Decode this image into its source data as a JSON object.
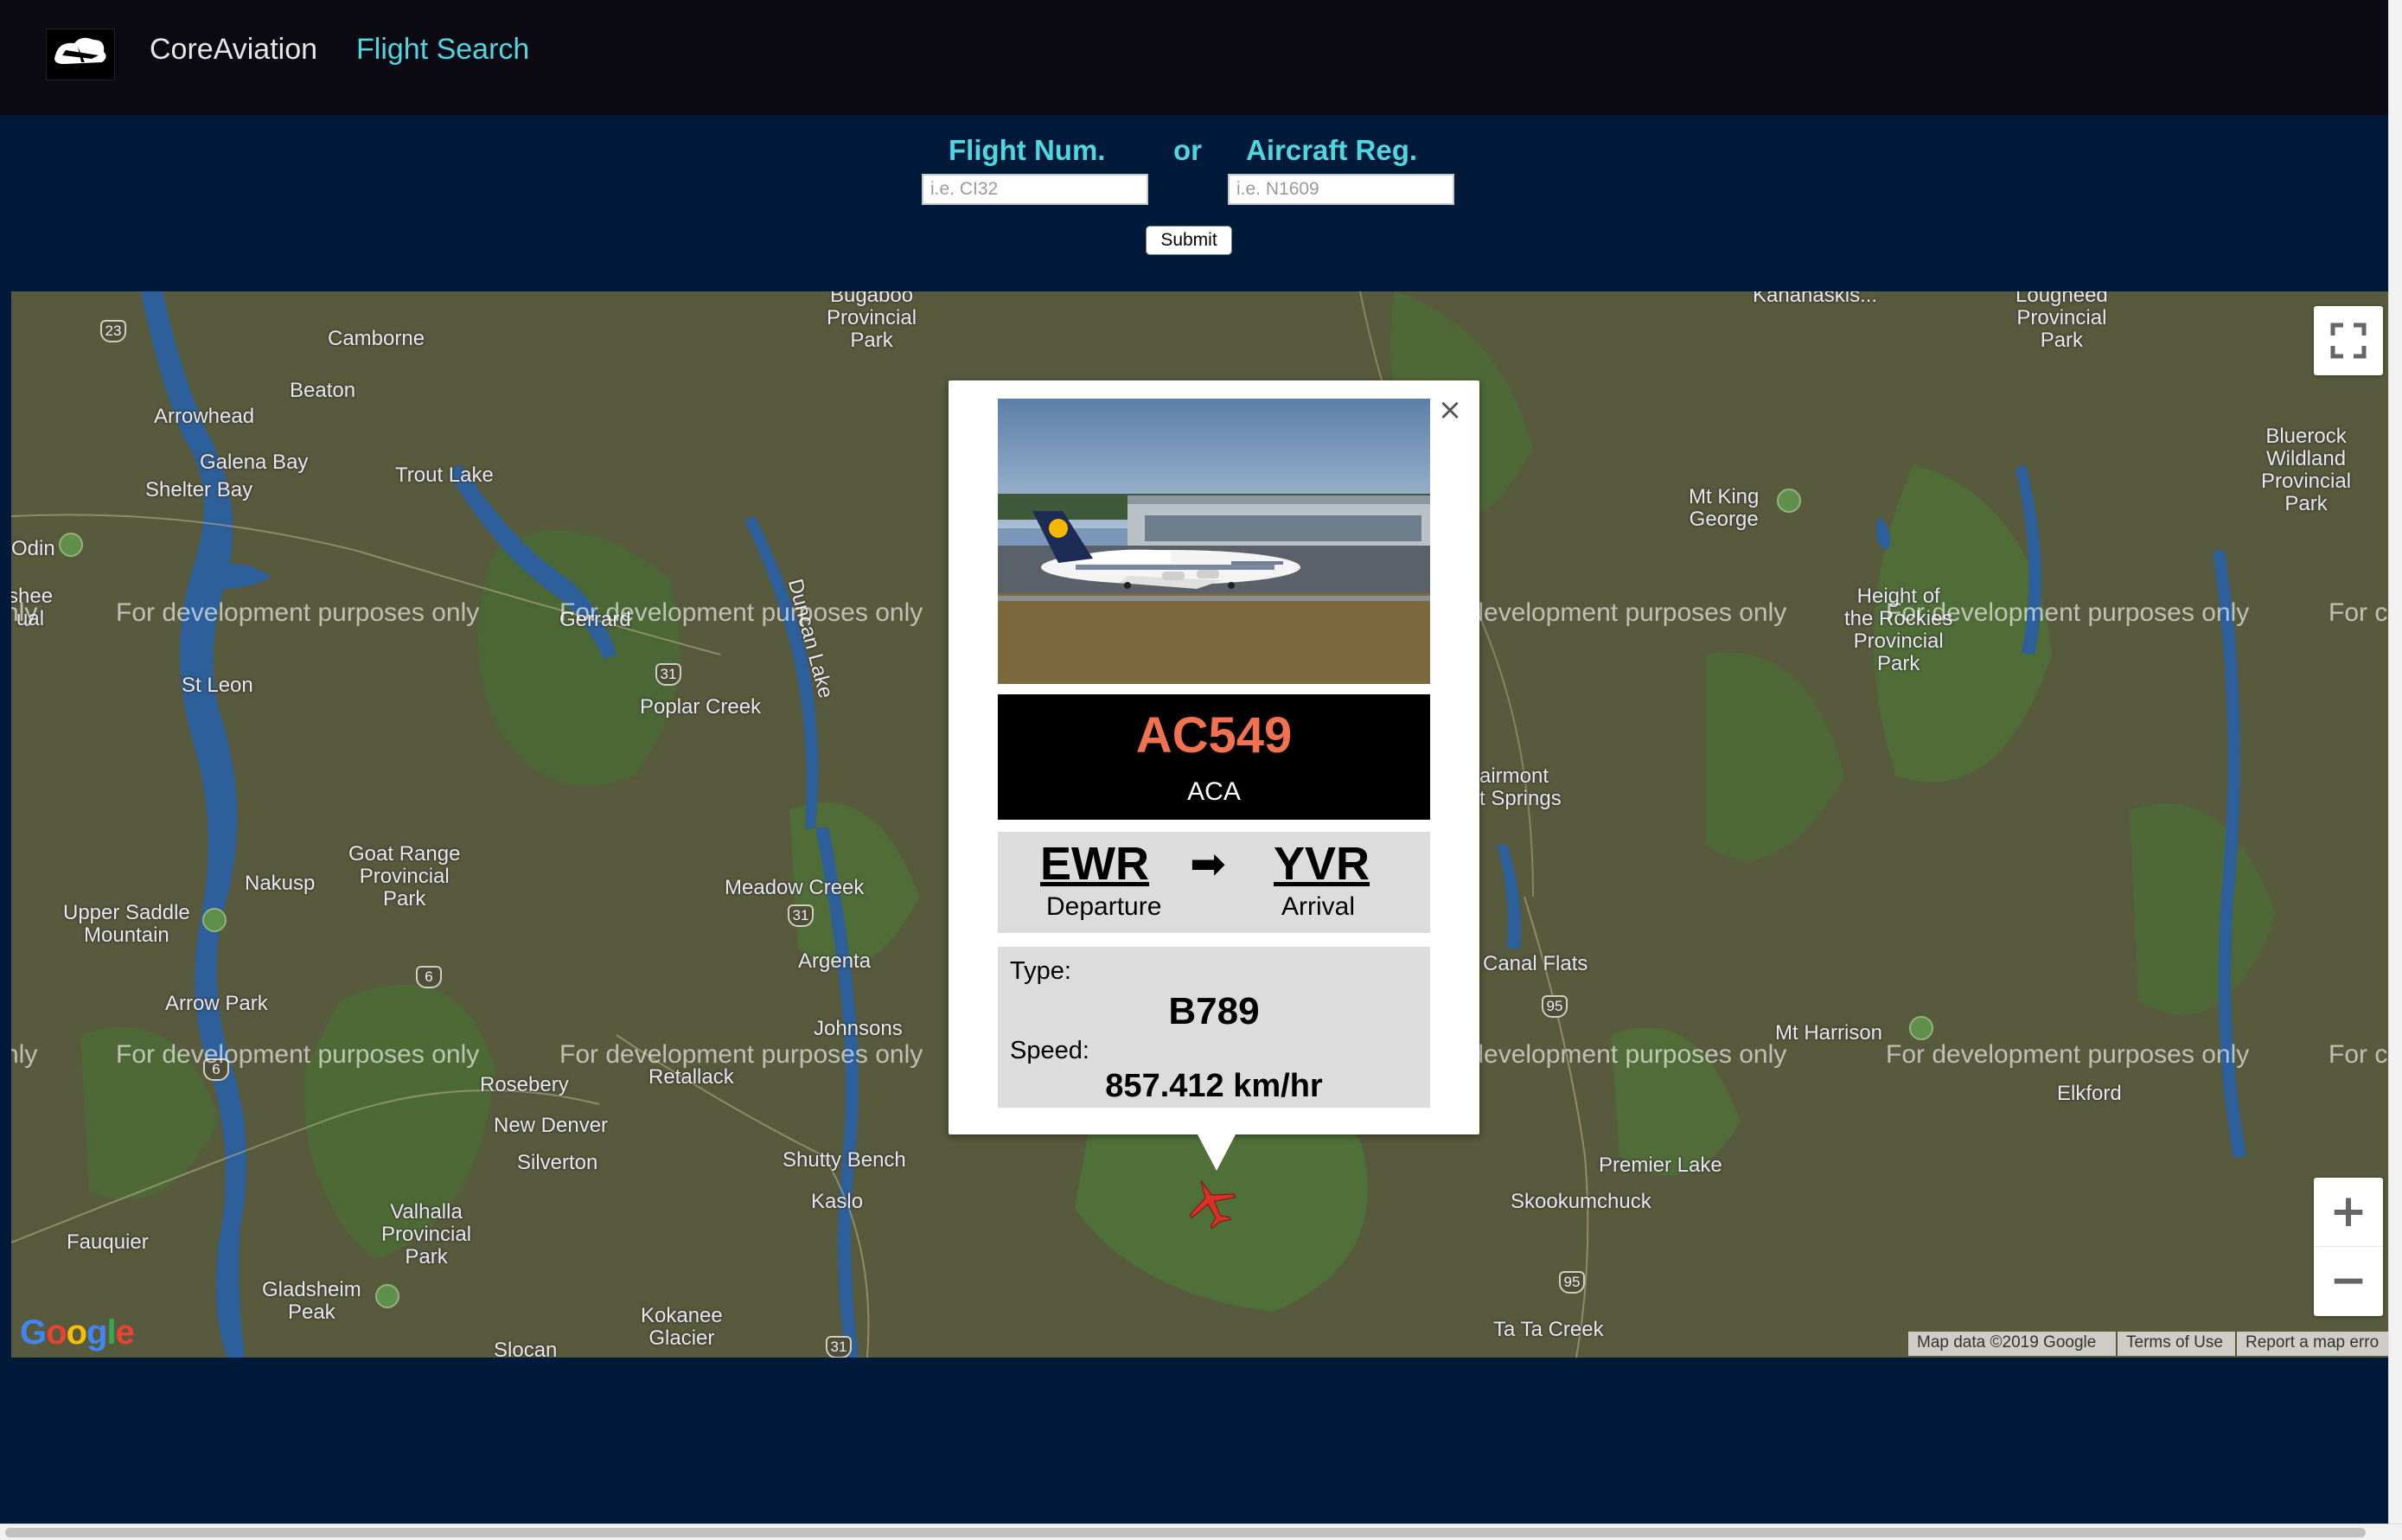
{
  "navbar": {
    "logo_icon": "plane-cloud-logo",
    "brand": "CoreAviation",
    "link": "Flight Search"
  },
  "search": {
    "flight_label": "Flight Num.",
    "or_label": "or",
    "reg_label": "Aircraft Reg.",
    "flight_placeholder": "i.e. CI32",
    "reg_placeholder": "i.e. N1609",
    "submit_label": "Submit"
  },
  "map": {
    "watermark": "For development purposes only",
    "labels": {
      "camborne": "Camborne",
      "beaton": "Beaton",
      "arrowhead": "Arrowhead",
      "galena_bay": "Galena Bay",
      "shelter_bay": "Shelter Bay",
      "trout_lake": "Trout Lake",
      "odin": "Odin",
      "st_leon": "St Leon",
      "poplar_creek": "Poplar Creek",
      "goat_range": "Goat Range\nProvincial\nPark",
      "meadow_creek": "Meadow Creek",
      "nakusp": "Nakusp",
      "upper_saddle": "Upper Saddle\nMountain",
      "argenta": "Argenta",
      "arrow_park": "Arrow Park",
      "johnsons": "Johnsons",
      "retallack": "Retallack",
      "rosebery": "Rosebery",
      "new_denver": "New Denver",
      "silverton": "Silverton",
      "shutty_bench": "Shutty Bench",
      "kaslo": "Kaslo",
      "valhalla": "Valhalla\nProvincial\nPark",
      "fauquier": "Fauquier",
      "gladsheim": "Gladsheim\nPeak",
      "kokanee": "Kokanee\nGlacier",
      "slocan": "Slocan",
      "bugaboo": "Bugaboo\nProvincial\nPark",
      "kananaskis": "Kananaskis...",
      "lougheed": "Lougheed\nProvincial\nPark",
      "bluerock": "Bluerock\nWildland\nProvincial\nPark",
      "mt_king_george": "Mt King\nGeorge",
      "height_of_rockies": "Height of\nthe Rockies\nProvincial\nPark",
      "fairmont": "airmont\nt Springs",
      "canal_flats": "Canal Flats",
      "mt_harrison": "Mt Harrison",
      "elkford": "Elkford",
      "premier_lake": "Premier Lake",
      "skookumchuck": "Skookumchuck",
      "ta_ta_creek": "Ta Ta Creek",
      "duncan_lake": "Duncan Lake",
      "gerrard": "Gerrard",
      "shee_al": "shee\nual",
      "nly": "nly",
      "for_c": "For c"
    },
    "routes": {
      "r23": "23",
      "r31a": "31",
      "r31b": "31",
      "r31c": "31",
      "r6a": "6",
      "r6b": "6",
      "r95a": "95",
      "r95b": "95"
    },
    "google_logo": "Google",
    "attribution_data": "Map data ©2019 Google",
    "attribution_terms": "Terms of Use",
    "attribution_report": "Report a map erro",
    "zoom_in": "+",
    "zoom_out": "−",
    "icons": {
      "fullscreen": "fullscreen-icon",
      "plane_marker": "plane-icon"
    }
  },
  "info_window": {
    "close": "×",
    "callsign": "AC549",
    "airline": "ACA",
    "departure_code": "EWR",
    "departure_label": "Departure",
    "arrival_code": "YVR",
    "arrival_label": "Arrival",
    "arrow": "➡",
    "type_label": "Type:",
    "type_value": "B789",
    "speed_label": "Speed:",
    "speed_value": "857.412 km/hr",
    "colors": {
      "callsign": "#f2714f",
      "callsign_bg": "#000000",
      "panel_bg": "#dcdcdc"
    }
  },
  "colors": {
    "navbar_bg": "#0b0a12",
    "page_bg": "#021a3a",
    "accent": "#4fd6e0",
    "marker": "#d8312a"
  }
}
